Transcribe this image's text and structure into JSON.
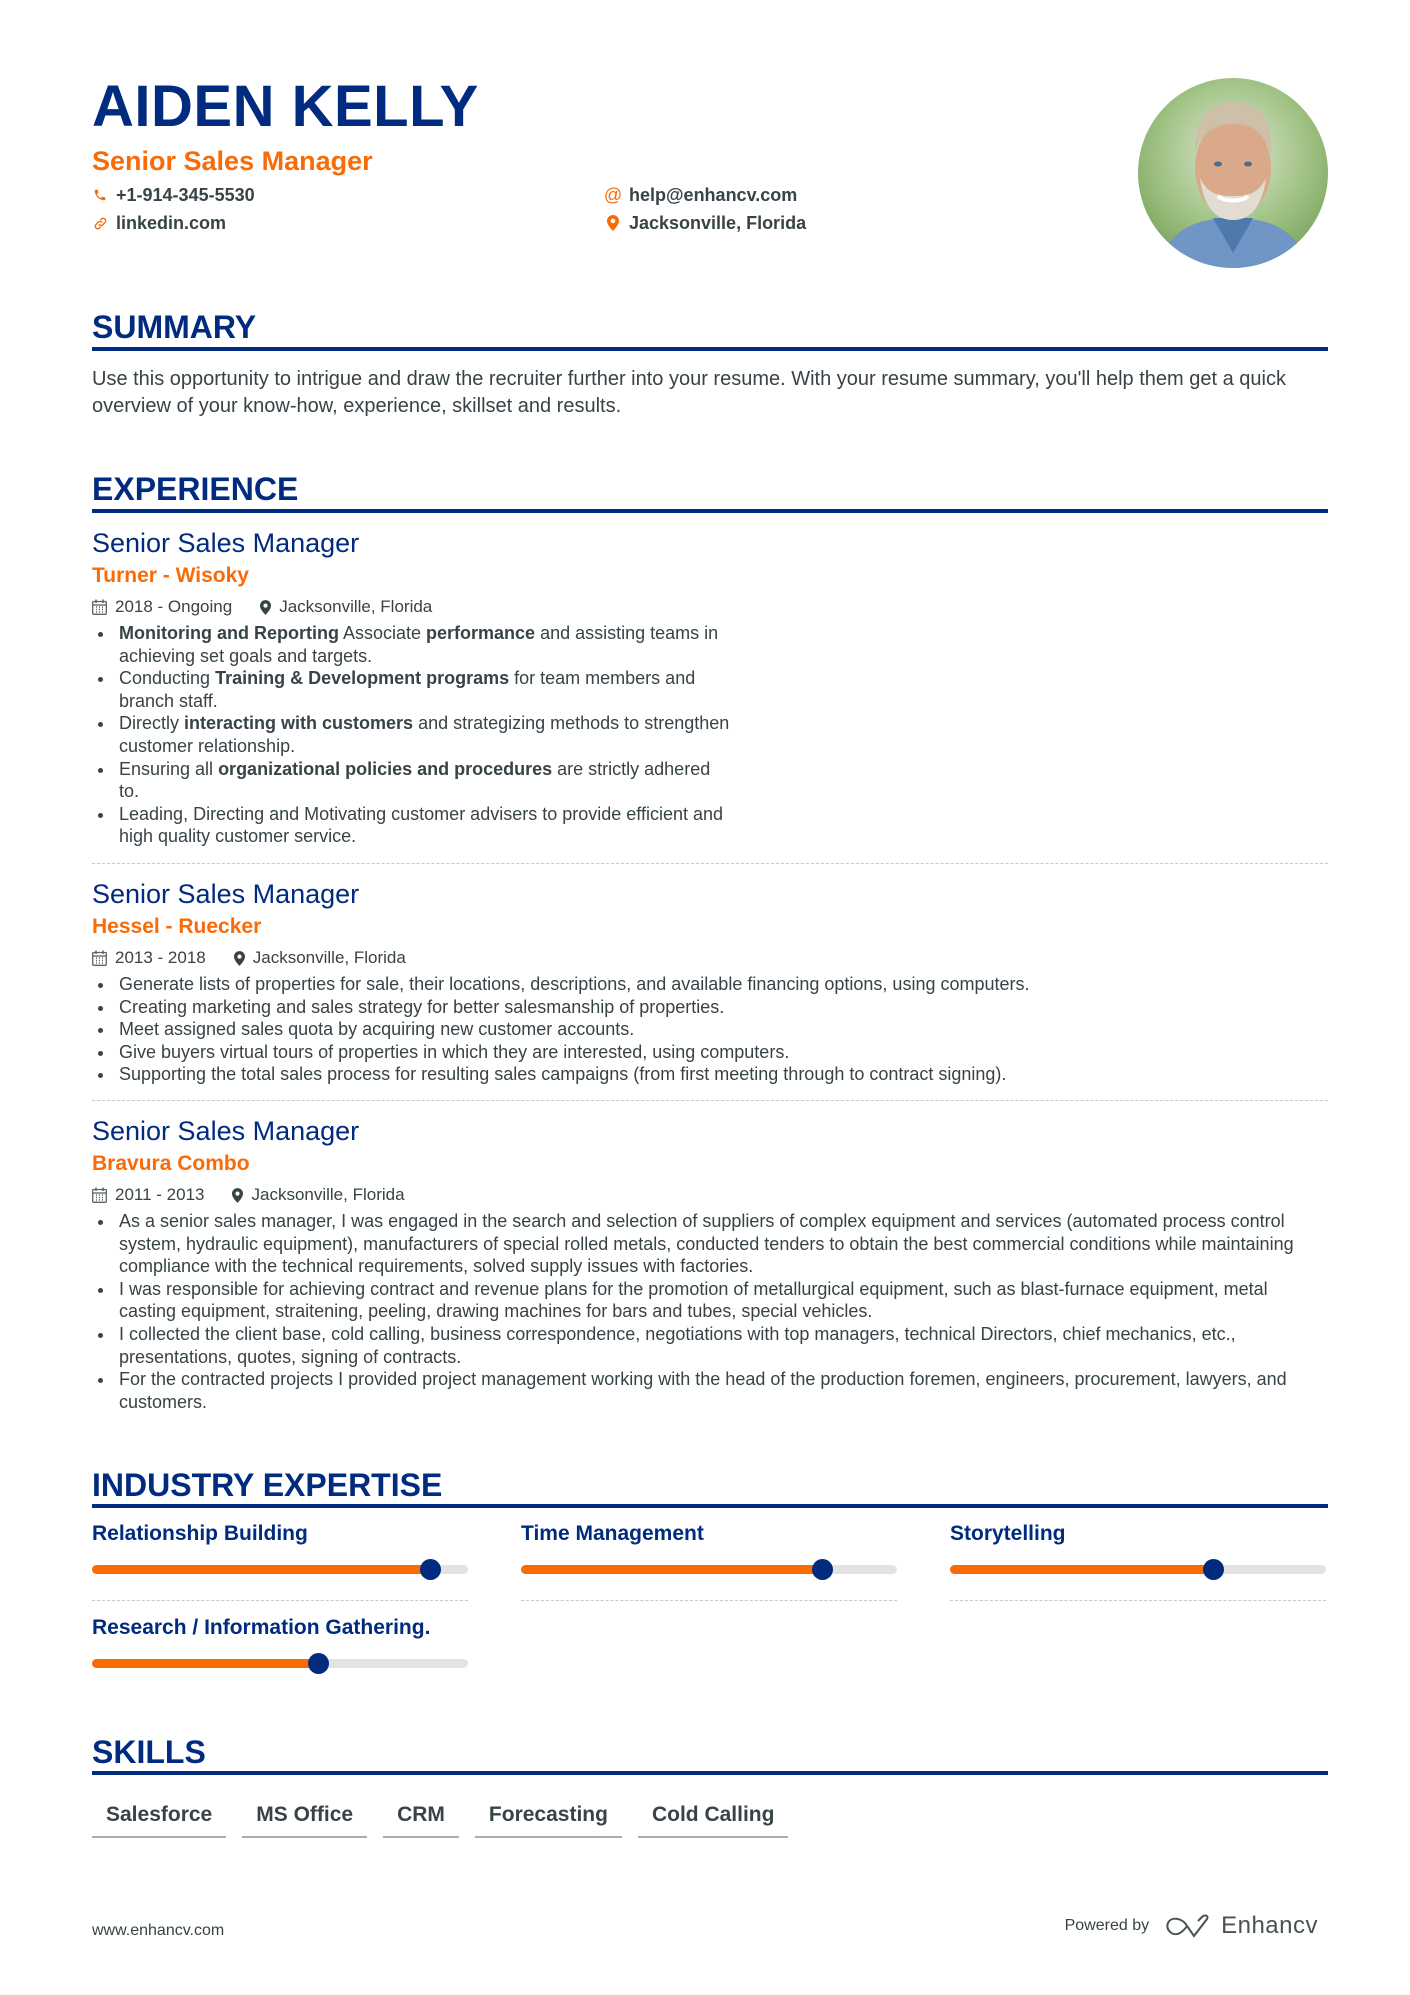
{
  "header": {
    "name": "AIDEN KELLY",
    "role": "Senior Sales Manager",
    "contacts": {
      "phone": {
        "icon": "phone-icon",
        "value": "+1-914-345-5530"
      },
      "email": {
        "icon": "at-icon",
        "value": "help@enhancv.com"
      },
      "linkedin": {
        "icon": "link-icon",
        "value": "linkedin.com"
      },
      "location": {
        "icon": "location-pin-icon",
        "value": "Jacksonville, Florida"
      }
    },
    "photo_alt": "Profile photo"
  },
  "summary": {
    "title": "SUMMARY",
    "text": "Use this opportunity to intrigue and draw the recruiter further into your resume. With your resume summary, you'll help them get a quick overview of your know-how, experience, skillset and results."
  },
  "experience": {
    "title": "EXPERIENCE",
    "jobs": [
      {
        "title": "Senior Sales Manager",
        "company": "Turner - Wisoky",
        "dates": "2018 - Ongoing",
        "location": "Jacksonville, Florida",
        "bullets": [
          [
            {
              "b": "Monitoring and Reporting"
            },
            {
              "t": " Associate "
            },
            {
              "b": "performance"
            },
            {
              "t": " and assisting teams in achieving set goals and targets."
            }
          ],
          [
            {
              "t": "Conducting "
            },
            {
              "b": "Training & Development programs"
            },
            {
              "t": " for team members and branch staff."
            }
          ],
          [
            {
              "t": "Directly "
            },
            {
              "b": "interacting with customers"
            },
            {
              "t": " and strategizing methods to strengthen customer relationship."
            }
          ],
          [
            {
              "t": "Ensuring all "
            },
            {
              "b": "organizational policies and procedures"
            },
            {
              "t": " are strictly adhered to."
            }
          ],
          [
            {
              "t": "Leading, Directing and Motivating customer advisers to provide efficient and high quality customer service."
            }
          ]
        ]
      },
      {
        "title": "Senior Sales Manager",
        "company": "Hessel - Ruecker",
        "dates": "2013 - 2018",
        "location": "Jacksonville, Florida",
        "bullets": [
          [
            {
              "t": "Generate lists of properties for sale, their locations, descriptions, and available financing options, using computers."
            }
          ],
          [
            {
              "t": "Creating marketing and sales strategy for better salesmanship of properties."
            }
          ],
          [
            {
              "t": "Meet assigned sales quota by acquiring new customer accounts."
            }
          ],
          [
            {
              "t": "Give buyers virtual tours of properties in which they are interested, using computers."
            }
          ],
          [
            {
              "t": "Supporting the total sales process for resulting sales campaigns (from first meeting through to contract signing)."
            }
          ]
        ]
      },
      {
        "title": "Senior Sales Manager",
        "company": "Bravura Combo",
        "dates": "2011 - 2013",
        "location": "Jacksonville, Florida",
        "bullets": [
          [
            {
              "t": "As a senior sales manager, I was engaged in the search and selection of suppliers of complex equipment and services (automated process control system, hydraulic equipment), manufacturers of special rolled metals, conducted tenders to obtain the best commercial conditions while maintaining compliance with the technical requirements, solved supply issues with factories."
            }
          ],
          [
            {
              "t": "I was responsible for achieving contract and revenue plans for the promotion of metallurgical equipment, such as blast-furnace equipment, metal casting equipment, straitening, peeling, drawing machines for bars and tubes, special vehicles."
            }
          ],
          [
            {
              "t": "I collected the client base, cold calling, business correspondence, negotiations with top managers, technical Directors, chief mechanics, etc., presentations, quotes, signing of contracts."
            }
          ],
          [
            {
              "t": "For the contracted projects I provided project management working with the head of the production foremen, engineers, procurement, lawyers, and customers."
            }
          ]
        ]
      }
    ]
  },
  "expertise": {
    "title": "INDUSTRY EXPERTISE",
    "items": [
      {
        "label": "Relationship Building",
        "level": 0.9
      },
      {
        "label": "Time Management",
        "level": 0.8
      },
      {
        "label": "Storytelling",
        "level": 0.7
      },
      {
        "label": "Research / Information Gathering.",
        "level": 0.6
      }
    ]
  },
  "skills": {
    "title": "SKILLS",
    "tags": [
      "Salesforce",
      "MS Office",
      "CRM",
      "Forecasting",
      "Cold Calling"
    ]
  },
  "footer": {
    "website": "www.enhancv.com",
    "powered_by": "Powered by",
    "brand": "Enhancv"
  },
  "colors": {
    "primary": "#002b7f",
    "accent": "#f96b07",
    "text": "#384347",
    "track": "#e3e3e3"
  }
}
